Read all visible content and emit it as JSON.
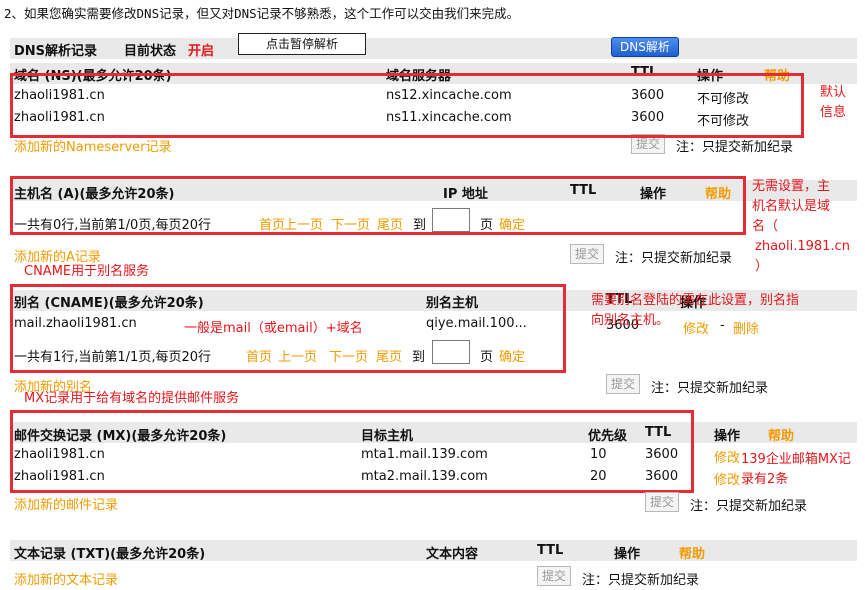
{
  "top_note": "2、如果您确实需要修改DNS记录，但又对DNS记录不够熟悉，这个工作可以交由我们来完成。",
  "dns": {
    "title": "DNS解析记录",
    "status_label": "目前状态",
    "status_value": "开启",
    "pause_button": "点击暂停解析",
    "dns_button": "DNS解析"
  },
  "ns": {
    "headers": [
      "域名 (NS)(最多允许20条)",
      "域名服务器",
      "TTL",
      "操作",
      "帮助"
    ],
    "rows": [
      {
        "domain": "zhaoli1981.cn",
        "server": "ns12.xincache.com",
        "ttl": "3600",
        "op": "不可修改"
      },
      {
        "domain": "zhaoli1981.cn",
        "server": "ns11.xincache.com",
        "ttl": "3600",
        "op": "不可修改"
      }
    ],
    "add_link": "添加新的Nameserver记录",
    "submit": "提交",
    "note": "注：只提交新加纪录"
  },
  "a": {
    "headers": [
      "主机名 (A)(最多允许20条)",
      "IP 地址",
      "TTL",
      "操作",
      "帮助"
    ],
    "paging_prefix": "一共有0行,当前第1/0页,每页20行",
    "first": "首页",
    "prev": "上一页",
    "next": "下一页",
    "last": "尾页",
    "goto": "到",
    "page_unit": "页",
    "confirm": "确定",
    "add_link": "添加新的A记录",
    "submit": "提交",
    "note": "注：只提交新加纪录"
  },
  "cname": {
    "headers": [
      "别名 (CNAME)(最多允许20条)",
      "别名主机",
      "TTL",
      "操作"
    ],
    "row": {
      "alias": "mail.zhaoli1981.cn",
      "host": "qiye.mail.100...",
      "ttl": "3600",
      "edit": "修改",
      "dash": "-",
      "del": "删除"
    },
    "paging_prefix": "一共有1行,当前第1/1页,每页20行",
    "first": "首页",
    "prev": "上一页",
    "next": "下一页",
    "last": "尾页",
    "goto": "到",
    "page_unit": "页",
    "confirm": "确定",
    "add_link": "添加新的别名",
    "submit": "提交",
    "note": "注：只提交新加纪录"
  },
  "mx": {
    "headers": [
      "邮件交换记录 (MX)(最多允许20条)",
      "目标主机",
      "优先级",
      "TTL",
      "操作",
      "帮助"
    ],
    "rows": [
      {
        "domain": "zhaoli1981.cn",
        "host": "mta1.mail.139.com",
        "priority": "10",
        "ttl": "3600",
        "op": "修改"
      },
      {
        "domain": "zhaoli1981.cn",
        "host": "mta2.mail.139.com",
        "priority": "20",
        "ttl": "3600",
        "op": "修改"
      }
    ],
    "add_link": "添加新的邮件记录",
    "submit": "提交",
    "note": "注：只提交新加纪录"
  },
  "txt": {
    "headers": [
      "文本记录 (TXT)(最多允许20条)",
      "文本内容",
      "TTL",
      "操作",
      "帮助"
    ],
    "add_link": "添加新的文本记录",
    "submit": "提交",
    "note": "注：只提交新加纪录"
  },
  "annotations": {
    "default_info_1": "默认",
    "default_info_2": "信息",
    "a_note_1": "无需设置，主",
    "a_note_2": "机名默认是域",
    "a_note_3": "名（",
    "a_note_4": "zhaoli.1981.cn",
    "a_note_5": "）",
    "cname_label": "CNAME用于别名服务",
    "cname_note_1": "需要别名登陆的需在此设置，别名指",
    "cname_note_2": "向别名主机。",
    "cname_row_note": "一般是mail（或email）+域名",
    "mx_label": "MX记录用于给有域名的提供邮件服务",
    "mx_note_1": "139企业邮箱MX记",
    "mx_note_2": "录有2条"
  }
}
